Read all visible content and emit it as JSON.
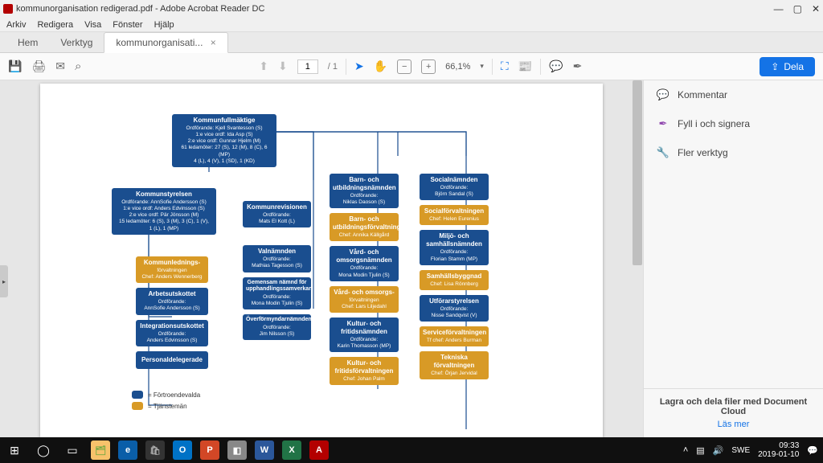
{
  "window": {
    "title": "kommunorganisation redigerad.pdf - Adobe Acrobat Reader DC",
    "min": "—",
    "max": "▢",
    "close": "✕"
  },
  "menu": {
    "items": [
      "Arkiv",
      "Redigera",
      "Visa",
      "Fönster",
      "Hjälp"
    ]
  },
  "tabs": {
    "hem": "Hem",
    "verktyg": "Verktyg",
    "doc": "kommunorganisati...",
    "x": "×"
  },
  "toolbar": {
    "page": "1",
    "pages": "/ 1",
    "zoom": "66,1%",
    "share": "Dela"
  },
  "panel": {
    "kommentar": "Kommentar",
    "fyll": "Fyll i och signera",
    "fler": "Fler verktyg",
    "promo": "Lagra och dela filer med Document Cloud",
    "more": "Läs mer"
  },
  "legend": {
    "a": "= Förtroendevalda",
    "b": "= Tjänstemän"
  },
  "taskbar": {
    "time": "09:33",
    "date": "2019-01-10"
  },
  "chart_data": {
    "type": "tree",
    "title": "",
    "kommunfullmaktige": {
      "title": "Kommunfullmäktige",
      "lines": [
        "Ordförande: Kjell Svantesson (S)",
        "1:e vice ordf: Ida Asp (S)",
        "2:e vice ordf: Gunnar Hjelm (M)",
        "61 ledamöter: 27 (S), 12 (M), 8 (C), 6 (MP)",
        "4 (L), 4 (V), 1 (SD), 1 (KD)"
      ]
    },
    "kommunstyrelsen": {
      "title": "Kommunstyrelsen",
      "lines": [
        "Ordförande: AnnSofie Andersson (S)",
        "1:e vice ordf: Anders Edvinsson (S)",
        "2:e vice ordf: Pär Jönsson (M)",
        "15 ledamöter: 6 (S), 3 (M), 3 (C), 1 (V),",
        "1 (L), 1 (MP)"
      ]
    },
    "ks_children_blue": [
      {
        "title": "Arbetsutskottet",
        "lines": [
          "Ordförande:",
          "AnnSofie Andersson (S)"
        ]
      },
      {
        "title": "Integrationsutskottet",
        "lines": [
          "Ordförande:",
          "Anders Edvinsson (S)"
        ]
      },
      {
        "title": "Personaldelegerade",
        "lines": []
      }
    ],
    "ks_children_yellow": [
      {
        "title": "Kommunlednings-",
        "lines": [
          "förvaltningen",
          "Chef: Anders Wennerberg"
        ]
      }
    ],
    "col2_blue": [
      {
        "title": "Kommunrevisionen",
        "lines": [
          "Ordförande:",
          "Mats El Kott (L)"
        ]
      },
      {
        "title": "Valnämnden",
        "lines": [
          "Ordförande:",
          "Mathias Tagesson (S)"
        ]
      },
      {
        "title": "Gemensam nämnd för upphandlingssamverkan",
        "lines": [
          "Ordförande:",
          "Mona Modin Tjulin (S)"
        ]
      },
      {
        "title": "Överförmyndarnämnden",
        "lines": [
          "Ordförande:",
          "Jim Nilsson (S)"
        ]
      }
    ],
    "col3": [
      {
        "c": "blue",
        "title": "Barn- och utbildningsnämnden",
        "lines": [
          "Ordförande:",
          "Niklas Daoson (S)"
        ]
      },
      {
        "c": "yellow",
        "title": "Barn- och utbildningsförvaltningen",
        "lines": [
          "Chef: Annika Källgård"
        ]
      },
      {
        "c": "blue",
        "title": "Vård- och omsorgsnämnden",
        "lines": [
          "Ordförande:",
          "Mona Modin Tjulin (S)"
        ]
      },
      {
        "c": "yellow",
        "title": "Vård- och omsorgs-",
        "lines": [
          "förvaltningen",
          "Chef: Lars Liljedahl"
        ]
      },
      {
        "c": "blue",
        "title": "Kultur- och fritidsnämnden",
        "lines": [
          "Ordförande:",
          "Karin Thomasson (MP)"
        ]
      },
      {
        "c": "yellow",
        "title": "Kultur- och fritidsförvaltningen",
        "lines": [
          "Chef: Johan Palm"
        ]
      }
    ],
    "col4": [
      {
        "c": "blue",
        "title": "Socialnämnden",
        "lines": [
          "Ordförande:",
          "Björn Sandal (S)"
        ]
      },
      {
        "c": "yellow",
        "title": "Socialförvaltningen",
        "lines": [
          "Chef: Helen Eurenius"
        ]
      },
      {
        "c": "blue",
        "title": "Miljö- och samhällsnämnden",
        "lines": [
          "Ordförande:",
          "Florian Stamm (MP)"
        ]
      },
      {
        "c": "yellow",
        "title": "Samhällsbyggnad",
        "lines": [
          "Chef: Lisa Rönnberg"
        ]
      },
      {
        "c": "blue",
        "title": "Utförarstyrelsen",
        "lines": [
          "Ordförande:",
          "Nisse Sandqvist (V)"
        ]
      },
      {
        "c": "yellow",
        "title": "Serviceförvaltningen",
        "lines": [
          "Tf chef: Anders Burman"
        ]
      },
      {
        "c": "yellow",
        "title": "Tekniska förvaltningen",
        "lines": [
          "Chef: Örjan Jervidal"
        ]
      }
    ]
  }
}
